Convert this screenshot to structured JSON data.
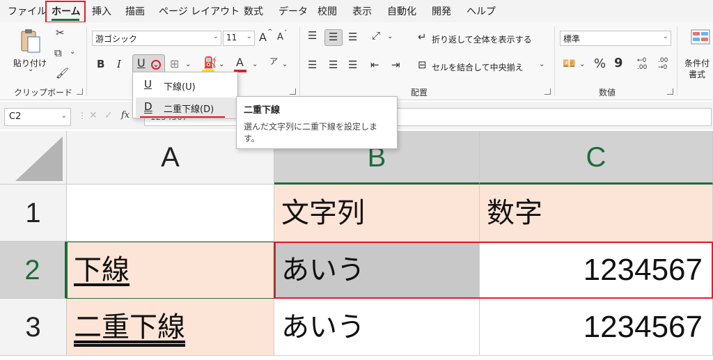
{
  "menu_tabs": [
    "ファイル",
    "ホーム",
    "挿入",
    "描画",
    "ページ レイアウト",
    "数式",
    "データ",
    "校閲",
    "表示",
    "自動化",
    "開発",
    "ヘルプ"
  ],
  "ribbon": {
    "clipboard": {
      "paste_label": "貼り付け",
      "group_label": "クリップボード"
    },
    "font": {
      "font_name": "游ゴシック",
      "font_size": "11",
      "grow_label": "A",
      "shrink_label": "A",
      "bold_label": "B",
      "italic_label": "I",
      "underline_label": "U",
      "fontcolor_label": "A"
    },
    "alignment": {
      "wrap_label": "折り返して全体を表示する",
      "merge_label": "セルを結合して中央揃え",
      "group_label": "配置"
    },
    "number": {
      "format_value": "標準",
      "percent_label": "%",
      "comma_label": "9",
      "inc_label": "←0\n.00",
      "dec_label": ".00\n→0",
      "group_label": "数値"
    },
    "styles": {
      "conditional_label": "条件付",
      "format_label": "書式"
    }
  },
  "formula_bar": {
    "name_box": "C2",
    "fx_label": "fx",
    "value": "1234567"
  },
  "grid": {
    "columns": [
      "A",
      "B",
      "C"
    ],
    "rows": [
      {
        "num": "1",
        "cells": [
          "",
          "文字列",
          "数字"
        ]
      },
      {
        "num": "2",
        "cells": [
          "下線",
          "あいう",
          "1234567"
        ]
      },
      {
        "num": "3",
        "cells": [
          "二重下線",
          "あいう",
          "1234567"
        ]
      }
    ]
  },
  "underline_dropdown": {
    "items": [
      {
        "glyph": "U",
        "label": "下線(U)"
      },
      {
        "glyph": "D",
        "label": "二重下線(D)"
      }
    ]
  },
  "tooltip": {
    "title": "二重下線",
    "description": "選んだ文字列に二重下線を設定します。"
  },
  "colors": {
    "accent_green": "#1e6b3b",
    "highlight_red": "#e11d2b",
    "peach": "#fce4d6",
    "selected_grey": "#c8c8c8"
  }
}
